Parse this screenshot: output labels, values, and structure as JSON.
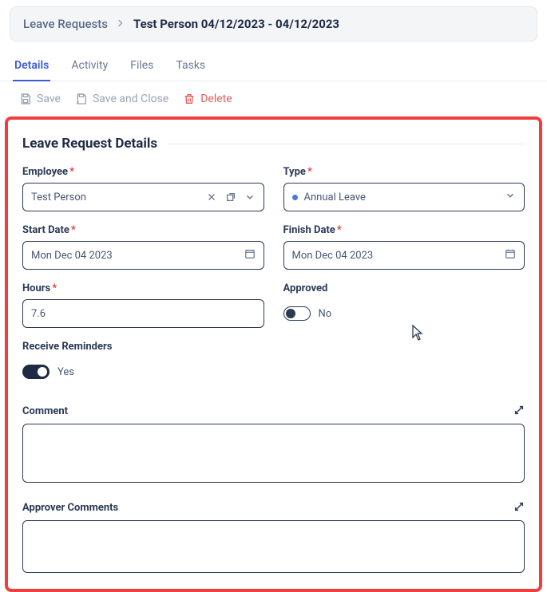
{
  "breadcrumb": {
    "root": "Leave Requests",
    "current": "Test Person 04/12/2023 - 04/12/2023"
  },
  "tabs": {
    "details": "Details",
    "activity": "Activity",
    "files": "Files",
    "tasks": "Tasks"
  },
  "toolbar": {
    "save": "Save",
    "save_close": "Save and Close",
    "delete": "Delete"
  },
  "section": {
    "title": "Leave Request Details"
  },
  "fields": {
    "employee": {
      "label": "Employee",
      "value": "Test Person"
    },
    "type": {
      "label": "Type",
      "value": "Annual Leave"
    },
    "start_date": {
      "label": "Start Date",
      "value": "Mon Dec 04 2023"
    },
    "finish_date": {
      "label": "Finish Date",
      "value": "Mon Dec 04 2023"
    },
    "hours": {
      "label": "Hours",
      "value": "7.6"
    },
    "approved": {
      "label": "Approved",
      "value": "No",
      "on": false
    },
    "receive_reminders": {
      "label": "Receive Reminders",
      "value": "Yes",
      "on": true
    },
    "comment": {
      "label": "Comment",
      "value": ""
    },
    "approver_comments": {
      "label": "Approver Comments",
      "value": ""
    }
  }
}
